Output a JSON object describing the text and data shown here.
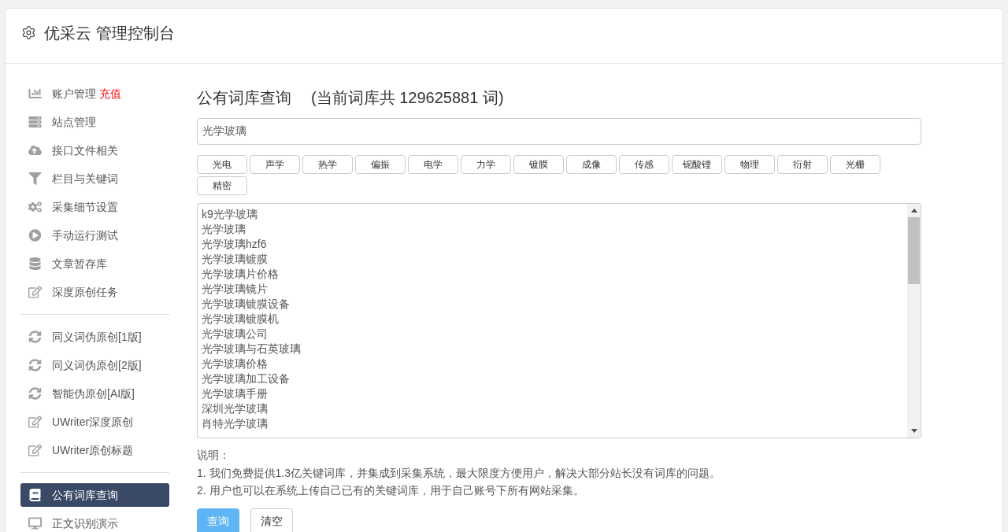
{
  "header": {
    "title": "优采云 管理控制台"
  },
  "sidebar": {
    "sections": [
      {
        "items": [
          {
            "label": "账户管理",
            "badge": "充值",
            "selected": false
          },
          {
            "label": "站点管理",
            "selected": false
          },
          {
            "label": "接口文件相关",
            "selected": false
          },
          {
            "label": "栏目与关键词",
            "selected": false
          },
          {
            "label": "采集细节设置",
            "selected": false
          },
          {
            "label": "手动运行测试",
            "selected": false
          },
          {
            "label": "文章暂存库",
            "selected": false
          },
          {
            "label": "深度原创任务",
            "selected": false
          }
        ]
      },
      {
        "items": [
          {
            "label": "同义词伪原创[1版]",
            "selected": false
          },
          {
            "label": "同义词伪原创[2版]",
            "selected": false
          },
          {
            "label": "智能伪原创[AI版]",
            "selected": false
          },
          {
            "label": "UWriter深度原创",
            "selected": false
          },
          {
            "label": "UWriter原创标题",
            "selected": false
          }
        ]
      },
      {
        "items": [
          {
            "label": "公有词库查询",
            "selected": true
          },
          {
            "label": "正文识别演示",
            "selected": false
          }
        ]
      }
    ]
  },
  "page": {
    "title": "公有词库查询",
    "subtitle": "(当前词库共 129625881 词)"
  },
  "search": {
    "value": "光学玻璃"
  },
  "tags": [
    "光电",
    "声学",
    "热学",
    "偏振",
    "电学",
    "力学",
    "镀膜",
    "成像",
    "传感",
    "铌酸锂",
    "物理",
    "衍射",
    "光栅",
    "精密"
  ],
  "results": {
    "lines": [
      "k9光学玻璃",
      "光学玻璃",
      "光学玻璃hzf6",
      "光学玻璃镀膜",
      "光学玻璃片价格",
      "光学玻璃镜片",
      "光学玻璃镀膜设备",
      "光学玻璃镀膜机",
      "光学玻璃公司",
      "光学玻璃与石英玻璃",
      "光学玻璃价格",
      "光学玻璃加工设备",
      "光学玻璃手册",
      "深圳光学玻璃",
      "肖特光学玻璃"
    ]
  },
  "notes": {
    "heading": "说明：",
    "lines": [
      "1. 我们免费提供1.3亿关键词库，并集成到采集系统，最大限度方便用户，解决大部分站长没有词库的问题。",
      "2. 用户也可以在系统上传自己已有的关键词库，用于自己账号下所有网站采集。"
    ]
  },
  "buttons": [
    {
      "label": "查询",
      "kind": "primary"
    },
    {
      "label": "清空",
      "kind": "secondary"
    }
  ]
}
